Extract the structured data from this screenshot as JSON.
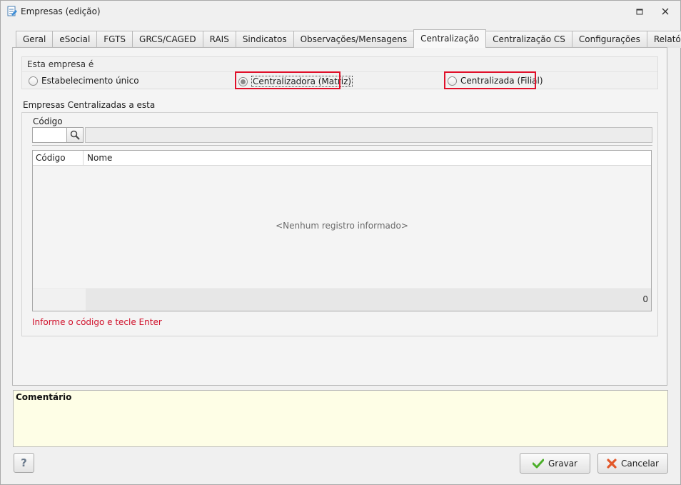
{
  "window": {
    "title": "Empresas (edição)",
    "icons": {
      "app": "document-edit-icon",
      "restore": "restore-icon",
      "close": "close-icon"
    }
  },
  "tabs": [
    {
      "label": "Geral",
      "active": false
    },
    {
      "label": "eSocial",
      "active": false
    },
    {
      "label": "FGTS",
      "active": false
    },
    {
      "label": "GRCS/CAGED",
      "active": false
    },
    {
      "label": "RAIS",
      "active": false
    },
    {
      "label": "Sindicatos",
      "active": false
    },
    {
      "label": "Observações/Mensagens",
      "active": false
    },
    {
      "label": "Centralização",
      "active": true
    },
    {
      "label": "Centralização CS",
      "active": false
    },
    {
      "label": "Configurações",
      "active": false
    },
    {
      "label": "Relatórios",
      "active": false
    }
  ],
  "empresa_tipo": {
    "legend": "Esta empresa é",
    "options": [
      {
        "label": "Estabelecimento único",
        "selected": false
      },
      {
        "label": "Centralizadora (Matriz)",
        "selected": true
      },
      {
        "label": "Centralizada (Filial)",
        "selected": false
      }
    ]
  },
  "centralizadas": {
    "title": "Empresas Centralizadas a esta",
    "codigo_label": "Código",
    "codigo_value": "",
    "nome_value": "",
    "columns": [
      "Código",
      "Nome"
    ],
    "rows": [],
    "empty_message": "<Nenhum registro informado>",
    "count": "0",
    "hint": "Informe o código e tecle Enter"
  },
  "comment": {
    "label": "Comentário",
    "value": ""
  },
  "buttons": {
    "help": "?",
    "save": "Gravar",
    "cancel": "Cancelar"
  },
  "colors": {
    "highlight": "#e0102a",
    "hint": "#d0102a",
    "comment_bg": "#fefee6",
    "save_check": "#4caf2a",
    "cancel_x": "#e2582a"
  }
}
